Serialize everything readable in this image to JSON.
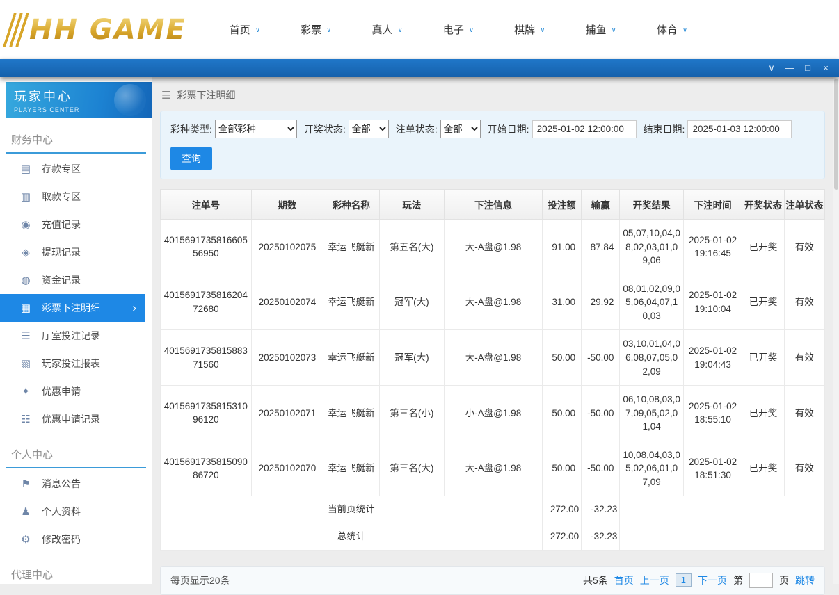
{
  "header": {
    "logo": "HH GAME",
    "nav": [
      "首页",
      "彩票",
      "真人",
      "电子",
      "棋牌",
      "捕鱼",
      "体育"
    ]
  },
  "window": {
    "chevron": "∨",
    "minimize": "—",
    "maximize": "□",
    "close": "×"
  },
  "icons": {
    "menu": "☰",
    "chevron_down": "∨",
    "chevron_right": "›"
  },
  "colors": {
    "accent_blue": "#1e88e5",
    "gold": "#d9a72b"
  },
  "sidebar": {
    "title": "玩家中心",
    "subtitle": "PLAYERS CENTER",
    "sections": [
      {
        "title": "财务中心",
        "items": [
          {
            "label": "存款专区",
            "icon": "▤"
          },
          {
            "label": "取款专区",
            "icon": "▥"
          },
          {
            "label": "充值记录",
            "icon": "◉"
          },
          {
            "label": "提现记录",
            "icon": "◈"
          },
          {
            "label": "资金记录",
            "icon": "◍"
          },
          {
            "label": "彩票下注明细",
            "icon": "▦"
          },
          {
            "label": "厅室投注记录",
            "icon": "☰"
          },
          {
            "label": "玩家投注报表",
            "icon": "▧"
          },
          {
            "label": "优惠申请",
            "icon": "✦"
          },
          {
            "label": "优惠申请记录",
            "icon": "☷"
          }
        ]
      },
      {
        "title": "个人中心",
        "items": [
          {
            "label": "消息公告",
            "icon": "⚑"
          },
          {
            "label": "个人资料",
            "icon": "♟"
          },
          {
            "label": "修改密码",
            "icon": "⚙"
          }
        ]
      },
      {
        "title": "代理中心",
        "items": []
      }
    ]
  },
  "breadcrumb": "彩票下注明细",
  "filters": {
    "lottery_type_label": "彩种类型:",
    "lottery_type_value": "全部彩种",
    "draw_status_label": "开奖状态:",
    "draw_status_value": "全部",
    "order_status_label": "注单状态:",
    "order_status_value": "全部",
    "start_date_label": "开始日期:",
    "start_date_value": "2025-01-02 12:00:00",
    "end_date_label": "结束日期:",
    "end_date_value": "2025-01-03 12:00:00",
    "search_button": "查询"
  },
  "table": {
    "headers": [
      "注单号",
      "期数",
      "彩种名称",
      "玩法",
      "下注信息",
      "投注额",
      "输赢",
      "开奖结果",
      "下注时间",
      "开奖状态",
      "注单状态"
    ],
    "rows": [
      [
        "401569173581660556950",
        "20250102075",
        "幸运飞艇新",
        "第五名(大)",
        "大-A盘@1.98",
        "91.00",
        "87.84",
        "05,07,10,04,08,02,03,01,09,06",
        "2025-01-02 19:16:45",
        "已开奖",
        "有效"
      ],
      [
        "401569173581620472680",
        "20250102074",
        "幸运飞艇新",
        "冠军(大)",
        "大-A盘@1.98",
        "31.00",
        "29.92",
        "08,01,02,09,05,06,04,07,10,03",
        "2025-01-02 19:10:04",
        "已开奖",
        "有效"
      ],
      [
        "401569173581588371560",
        "20250102073",
        "幸运飞艇新",
        "冠军(大)",
        "大-A盘@1.98",
        "50.00",
        "-50.00",
        "03,10,01,04,06,08,07,05,02,09",
        "2025-01-02 19:04:43",
        "已开奖",
        "有效"
      ],
      [
        "401569173581531096120",
        "20250102071",
        "幸运飞艇新",
        "第三名(小)",
        "小-A盘@1.98",
        "50.00",
        "-50.00",
        "06,10,08,03,07,09,05,02,01,04",
        "2025-01-02 18:55:10",
        "已开奖",
        "有效"
      ],
      [
        "401569173581509086720",
        "20250102070",
        "幸运飞艇新",
        "第三名(大)",
        "大-A盘@1.98",
        "50.00",
        "-50.00",
        "10,08,04,03,05,02,06,01,07,09",
        "2025-01-02 18:51:30",
        "已开奖",
        "有效"
      ]
    ],
    "summary": [
      {
        "label": "当前页统计",
        "bet": "272.00",
        "winloss": "-32.23"
      },
      {
        "label": "总统计",
        "bet": "272.00",
        "winloss": "-32.23"
      }
    ]
  },
  "pagination": {
    "page_size_text": "每页显示20条",
    "total_text": "共5条",
    "first": "首页",
    "prev": "上一页",
    "current_page": "1",
    "next": "下一页",
    "jump_prefix": "第",
    "jump_suffix": "页",
    "jump_button": "跳转"
  }
}
